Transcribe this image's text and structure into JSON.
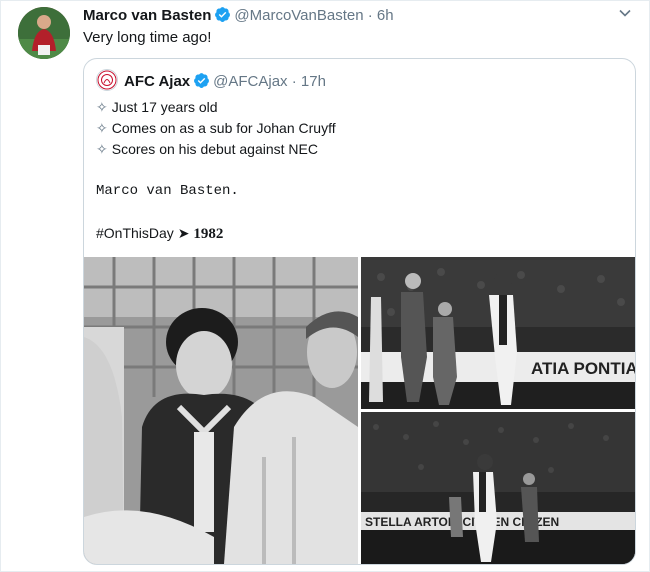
{
  "tweet": {
    "author_name": "Marco van Basten",
    "handle": "@MarcoVanBasten",
    "time": "· 6h",
    "text": "Very long time ago!"
  },
  "quoted": {
    "author_name": "AFC Ajax",
    "handle": "@AFCAjax",
    "time": "· 17h",
    "bullets": [
      "Just 17 years old",
      "Comes on as a sub for Johan Cruyff",
      "Scores on his debut against NEC"
    ],
    "bullet_glyph": "✧",
    "name_line": "Marco van Basten.",
    "hashtag": "#OnThisDay",
    "arrow": "➤",
    "year": "1982"
  },
  "media": {
    "banner_top": "ATIA  PONTIAC",
    "banner_bottom": "STELLA  ARTOIS  CITIZEN  CITIZEN"
  },
  "colors": {
    "verified": "#1da1f2",
    "muted": "#657786",
    "border": "#ccd6dd"
  },
  "icons": [
    "verified-badge-icon",
    "chevron-down-icon",
    "ajax-logo-icon"
  ]
}
